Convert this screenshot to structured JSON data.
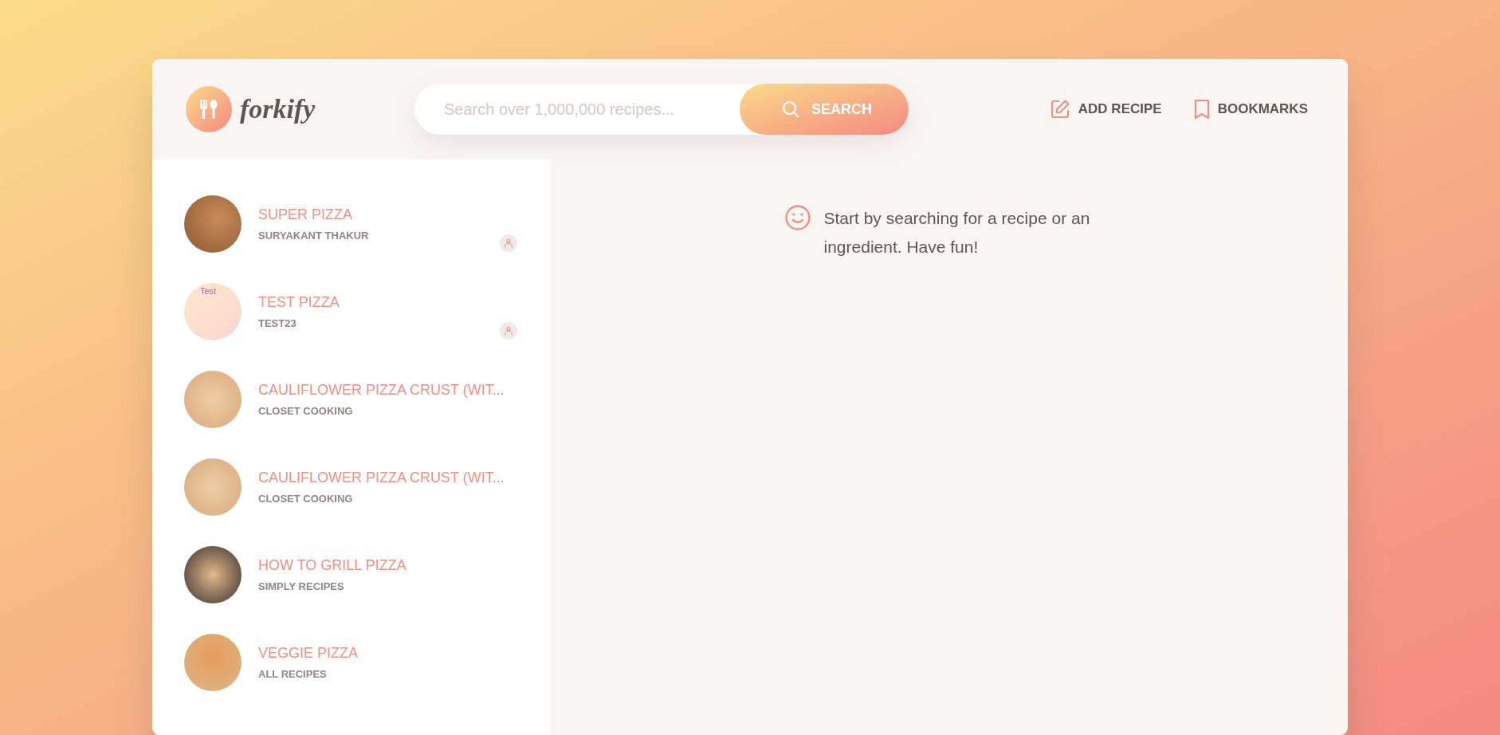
{
  "logo": {
    "text": "forkify"
  },
  "search": {
    "placeholder": "Search over 1,000,000 recipes...",
    "button": "SEARCH"
  },
  "nav": [
    {
      "kind": "edit",
      "label": "ADD RECIPE"
    },
    {
      "kind": "bookmark",
      "label": "BOOKMARKS"
    }
  ],
  "results": [
    {
      "title": "SUPER PIZZA",
      "publisher": "SURYAKANT THAKUR",
      "kind": "photo",
      "user_generated": true
    },
    {
      "title": "TEST PIZZA",
      "publisher": "TEST23",
      "kind": "broken",
      "image_alt": "Test",
      "user_generated": true
    },
    {
      "title": "CAULIFLOWER PIZZA CRUST (WIT...",
      "publisher": "CLOSET COOKING",
      "kind": "photo",
      "user_generated": false
    },
    {
      "title": "CAULIFLOWER PIZZA CRUST (WIT...",
      "publisher": "CLOSET COOKING",
      "kind": "photo",
      "user_generated": false
    },
    {
      "title": "HOW TO GRILL PIZZA",
      "publisher": "SIMPLY RECIPES",
      "kind": "photo",
      "user_generated": false
    },
    {
      "title": "VEGGIE PIZZA",
      "publisher": "ALL RECIPES",
      "kind": "photo",
      "user_generated": false
    }
  ],
  "message": "Start by searching for a recipe or an ingredient. Have fun!"
}
